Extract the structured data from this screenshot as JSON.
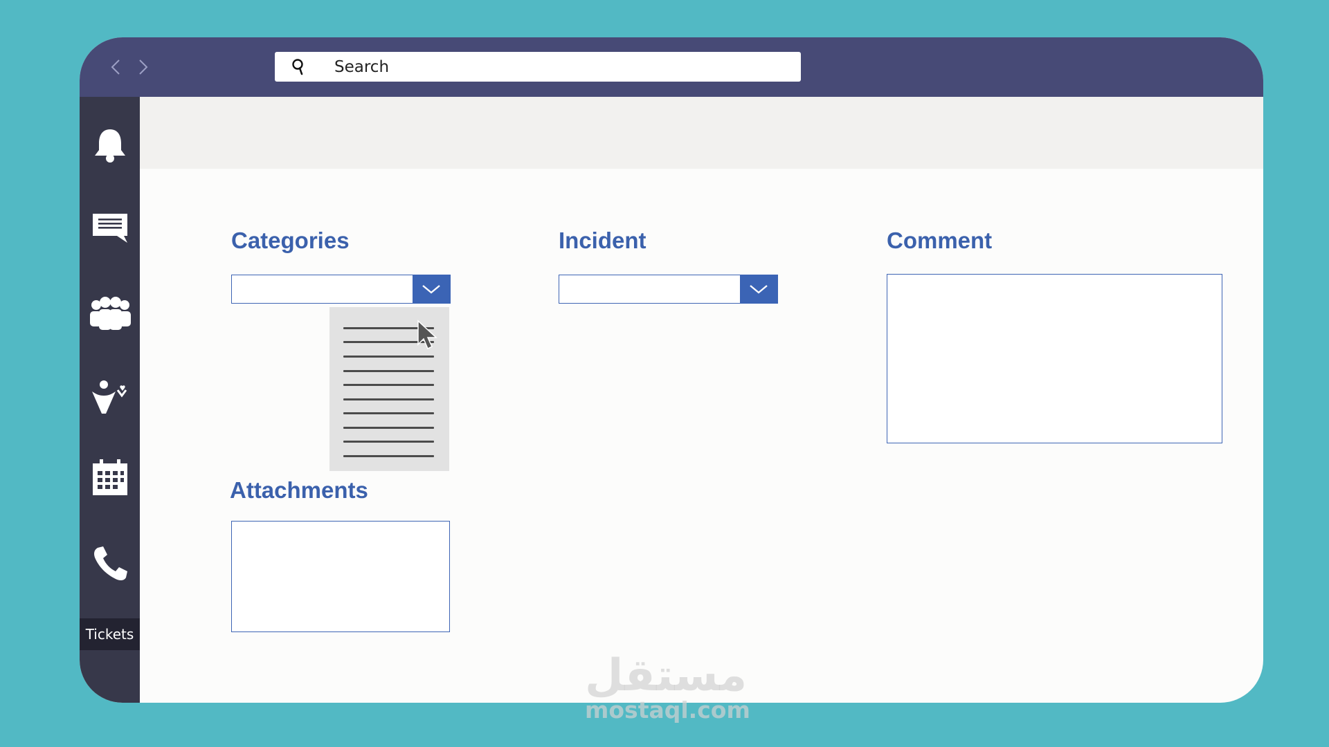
{
  "toolbar": {
    "search": {
      "placeholder": "Search",
      "value": ""
    }
  },
  "sidebar": {
    "items": [
      {
        "id": "notifications",
        "icon": "bell-icon"
      },
      {
        "id": "chat",
        "icon": "chat-icon"
      },
      {
        "id": "teams",
        "icon": "people-group-icon"
      },
      {
        "id": "activity",
        "icon": "user-heart-icon"
      },
      {
        "id": "calendar",
        "icon": "calendar-icon"
      },
      {
        "id": "calls",
        "icon": "phone-icon"
      }
    ],
    "active_label": "Tickets"
  },
  "form": {
    "categories": {
      "title": "Categories",
      "value": "",
      "dropdown_open": true
    },
    "incident": {
      "title": "Incident",
      "value": ""
    },
    "comment": {
      "title": "Comment",
      "value": ""
    },
    "attachments": {
      "title": "Attachments"
    }
  },
  "watermark": {
    "logo": "مستقل",
    "url": "mostaql.com"
  },
  "colors": {
    "background": "#52b9c4",
    "topbar": "#474a76",
    "sidebar": "#37384a",
    "sidebar_active": "#232331",
    "accent": "#3b64b5",
    "label": "#3b61ac",
    "header_strip": "#f2f1ef",
    "dropdown_list": "#e2e2e2"
  }
}
